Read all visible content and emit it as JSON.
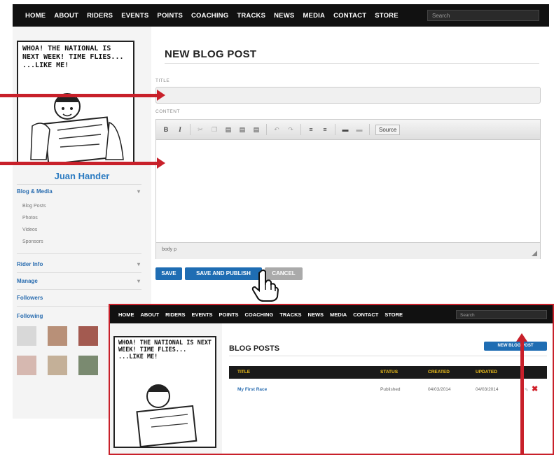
{
  "nav": {
    "items": [
      "HOME",
      "ABOUT",
      "RIDERS",
      "EVENTS",
      "POINTS",
      "COACHING",
      "TRACKS",
      "NEWS",
      "MEDIA",
      "CONTACT",
      "STORE"
    ],
    "search_placeholder": "Search"
  },
  "profile": {
    "comic_caption": "WHOA! THE NATIONAL IS NEXT WEEK! TIME FLIES... ...LIKE ME!",
    "name": "Juan Hander"
  },
  "sidebar": {
    "sections": [
      {
        "label": "Blog & Media",
        "subitems": [
          "Blog Posts",
          "Photos",
          "Videos",
          "Sponsors"
        ]
      },
      {
        "label": "Rider Info"
      },
      {
        "label": "Manage"
      },
      {
        "label": "Followers"
      },
      {
        "label": "Following"
      }
    ]
  },
  "form": {
    "heading": "NEW BLOG POST",
    "title_label": "TITLE",
    "content_label": "CONTENT",
    "toolbar": {
      "bold": "B",
      "italic": "I",
      "source": "Source"
    },
    "statusbar_path": "body p",
    "buttons": {
      "save": "SAVE",
      "save_publish": "SAVE AND PUBLISH",
      "cancel": "CANCEL"
    }
  },
  "inset": {
    "heading": "BLOG POSTS",
    "new_post_button": "NEW BLOG POST",
    "table": {
      "headers": [
        "TITLE",
        "STATUS",
        "CREATED",
        "UPDATED"
      ],
      "rows": [
        {
          "title": "My First Race",
          "status": "Published",
          "created": "04/03/2014",
          "updated": "04/03/2014"
        }
      ]
    }
  },
  "colors": {
    "nav_bg": "#111111",
    "accent_blue": "#1f6db3",
    "annotation_red": "#c8202a",
    "table_header_text": "#f3c31b"
  }
}
